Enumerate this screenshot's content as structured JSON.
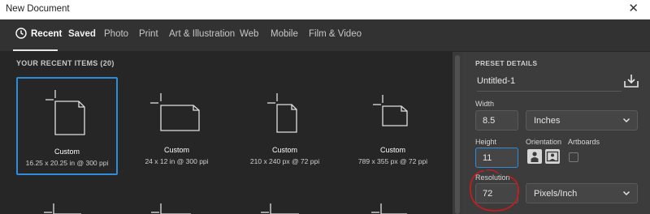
{
  "window": {
    "title": "New Document",
    "close_icon": "close-icon"
  },
  "tabs": [
    {
      "label": "Recent"
    },
    {
      "label": "Saved"
    },
    {
      "label": "Photo"
    },
    {
      "label": "Print"
    },
    {
      "label": "Art & Illustration"
    },
    {
      "label": "Web"
    },
    {
      "label": "Mobile"
    },
    {
      "label": "Film & Video"
    }
  ],
  "recent": {
    "title": "YOUR RECENT ITEMS  (20)",
    "items": [
      {
        "name": "Custom",
        "desc": "16.25 x 20.25 in @ 300 ppi",
        "icon": "portrait-document-icon"
      },
      {
        "name": "Custom",
        "desc": "24 x 12 in @ 300 ppi",
        "icon": "landscape-document-icon"
      },
      {
        "name": "Custom",
        "desc": "210 x 240 px @ 72 ppi",
        "icon": "portrait-document-icon"
      },
      {
        "name": "Custom",
        "desc": "789 x 355 px @ 72 ppi",
        "icon": "landscape-document-icon"
      }
    ]
  },
  "preset": {
    "header": "PRESET DETAILS",
    "name": "Untitled-1",
    "width_label": "Width",
    "width_value": "8.5",
    "width_unit": "Inches",
    "height_label": "Height",
    "height_value": "11",
    "orientation_label": "Orientation",
    "artboards_label": "Artboards",
    "resolution_label": "Resolution",
    "resolution_value": "72",
    "resolution_unit": "Pixels/Inch",
    "colors": {
      "accent": "#2e8cd9",
      "annotation": "#d01a1a"
    }
  }
}
